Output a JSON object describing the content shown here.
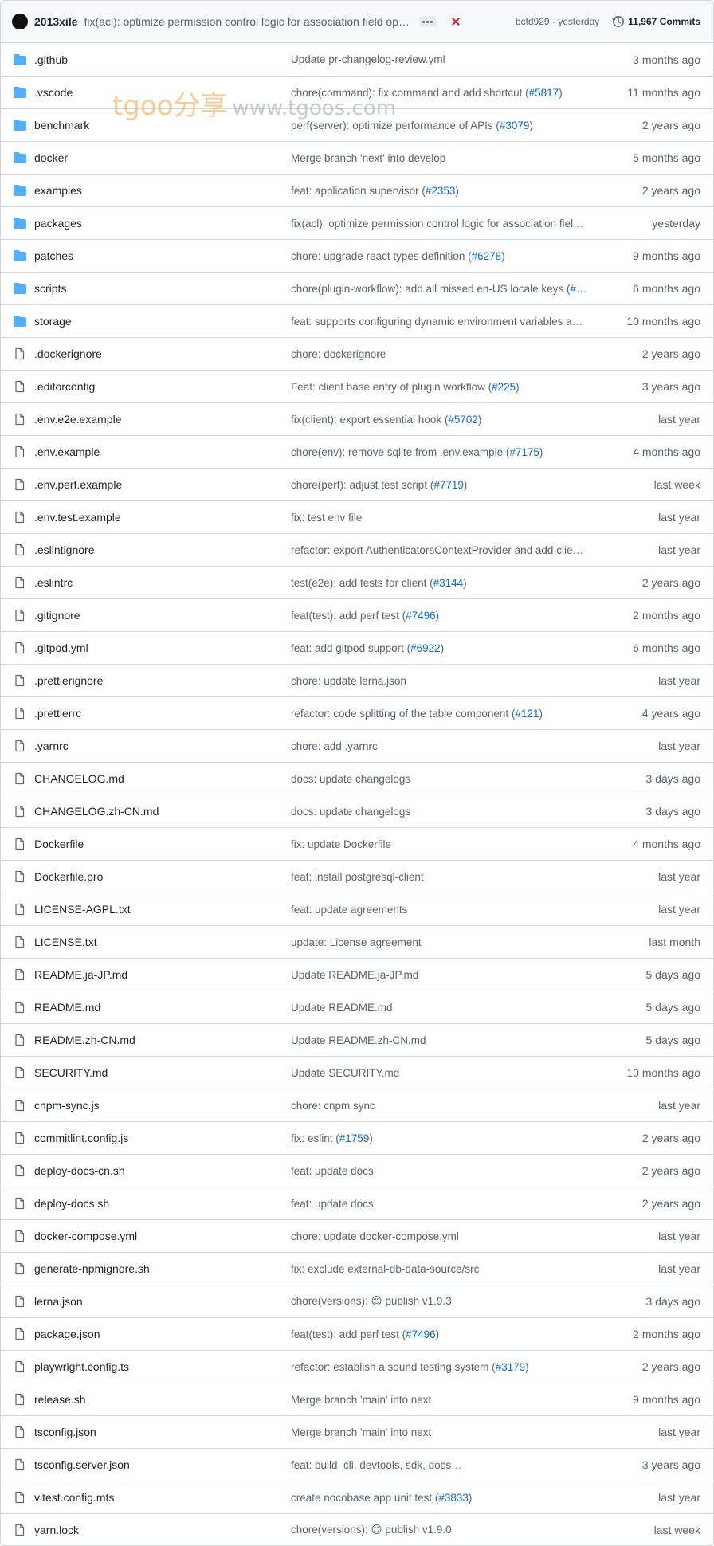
{
  "commit_bar": {
    "author": "2013xile",
    "message": "fix(acl): optimize permission control logic for association field operations",
    "sha": "bcfd929 · yesterday",
    "commits_label": "11,967 Commits"
  },
  "watermark": {
    "brand": "tgoo",
    "chinese": "分享",
    "url": "www.tgoos.com"
  },
  "colors": {
    "folder": "#54aeff",
    "link": "#0969da",
    "muted": "#59636e",
    "border": "#d0d7de",
    "failure": "#d1242f"
  },
  "files": [
    {
      "name": ".github",
      "type": "dir",
      "message": "Update pr-changelog-review.yml",
      "pr": "",
      "message_suffix": "",
      "age": "3 months ago"
    },
    {
      "name": ".vscode",
      "type": "dir",
      "message": "chore(command): fix command and add shortcut (",
      "pr": "#5817",
      "message_suffix": ")",
      "age": "11 months ago"
    },
    {
      "name": "benchmark",
      "type": "dir",
      "message": "perf(server): optimize performance of APIs (",
      "pr": "#3079",
      "message_suffix": ")",
      "age": "2 years ago"
    },
    {
      "name": "docker",
      "type": "dir",
      "message": "Merge branch 'next' into develop",
      "pr": "",
      "message_suffix": "",
      "age": "5 months ago"
    },
    {
      "name": "examples",
      "type": "dir",
      "message": "feat: application supervisor (",
      "pr": "#2353",
      "message_suffix": ")",
      "age": "2 years ago"
    },
    {
      "name": "packages",
      "type": "dir",
      "message": "fix(acl): optimize permission control logic for association fiel…",
      "pr": "",
      "message_suffix": "",
      "age": "yesterday"
    },
    {
      "name": "patches",
      "type": "dir",
      "message": "chore: upgrade react types definition (",
      "pr": "#6278",
      "message_suffix": ")",
      "age": "9 months ago"
    },
    {
      "name": "scripts",
      "type": "dir",
      "message": "chore(plugin-workflow): add all missed en-US locale keys (",
      "pr": "#…",
      "message_suffix": "",
      "age": "6 months ago"
    },
    {
      "name": "storage",
      "type": "dir",
      "message": "feat: supports configuring dynamic environment variables a…",
      "pr": "",
      "message_suffix": "",
      "age": "10 months ago"
    },
    {
      "name": ".dockerignore",
      "type": "file",
      "message": "chore: dockerignore",
      "pr": "",
      "message_suffix": "",
      "age": "2 years ago"
    },
    {
      "name": ".editorconfig",
      "type": "file",
      "message": "Feat: client base entry of plugin workflow (",
      "pr": "#225",
      "message_suffix": ")",
      "age": "3 years ago"
    },
    {
      "name": ".env.e2e.example",
      "type": "file",
      "message": "fix(client): export essential hook (",
      "pr": "#5702",
      "message_suffix": ")",
      "age": "last year"
    },
    {
      "name": ".env.example",
      "type": "file",
      "message": "chore(env): remove sqlite from .env.example (",
      "pr": "#7175",
      "message_suffix": ")",
      "age": "4 months ago"
    },
    {
      "name": ".env.perf.example",
      "type": "file",
      "message": "chore(perf): adjust test script (",
      "pr": "#7719",
      "message_suffix": ")",
      "age": "last week"
    },
    {
      "name": ".env.test.example",
      "type": "file",
      "message": "fix: test env file",
      "pr": "",
      "message_suffix": "",
      "age": "last year"
    },
    {
      "name": ".eslintignore",
      "type": "file",
      "message": "refactor: export AuthenticatorsContextProvider and add clie…",
      "pr": "",
      "message_suffix": "",
      "age": "last year"
    },
    {
      "name": ".eslintrc",
      "type": "file",
      "message": "test(e2e): add tests for client (",
      "pr": "#3144",
      "message_suffix": ")",
      "age": "2 years ago"
    },
    {
      "name": ".gitignore",
      "type": "file",
      "message": "feat(test): add perf test (",
      "pr": "#7496",
      "message_suffix": ")",
      "age": "2 months ago"
    },
    {
      "name": ".gitpod.yml",
      "type": "file",
      "message": "feat: add gitpod support (",
      "pr": "#6922",
      "message_suffix": ")",
      "age": "6 months ago"
    },
    {
      "name": ".prettierignore",
      "type": "file",
      "message": "chore: update lerna.json",
      "pr": "",
      "message_suffix": "",
      "age": "last year"
    },
    {
      "name": ".prettierrc",
      "type": "file",
      "message": "refactor: code splitting of the table component (",
      "pr": "#121",
      "message_suffix": ")",
      "age": "4 years ago"
    },
    {
      "name": ".yarnrc",
      "type": "file",
      "message": "chore: add .yarnrc",
      "pr": "",
      "message_suffix": "",
      "age": "last year"
    },
    {
      "name": "CHANGELOG.md",
      "type": "file",
      "message": "docs: update changelogs",
      "pr": "",
      "message_suffix": "",
      "age": "3 days ago"
    },
    {
      "name": "CHANGELOG.zh-CN.md",
      "type": "file",
      "message": "docs: update changelogs",
      "pr": "",
      "message_suffix": "",
      "age": "3 days ago"
    },
    {
      "name": "Dockerfile",
      "type": "file",
      "message": "fix: update Dockerfile",
      "pr": "",
      "message_suffix": "",
      "age": "4 months ago"
    },
    {
      "name": "Dockerfile.pro",
      "type": "file",
      "message": "feat: install postgresql-client",
      "pr": "",
      "message_suffix": "",
      "age": "last year"
    },
    {
      "name": "LICENSE-AGPL.txt",
      "type": "file",
      "message": "feat: update agreements",
      "pr": "",
      "message_suffix": "",
      "age": "last year"
    },
    {
      "name": "LICENSE.txt",
      "type": "file",
      "message": "update: License agreement",
      "pr": "",
      "message_suffix": "",
      "age": "last month"
    },
    {
      "name": "README.ja-JP.md",
      "type": "file",
      "message": "Update README.ja-JP.md",
      "pr": "",
      "message_suffix": "",
      "age": "5 days ago"
    },
    {
      "name": "README.md",
      "type": "file",
      "message": "Update README.md",
      "pr": "",
      "message_suffix": "",
      "age": "5 days ago"
    },
    {
      "name": "README.zh-CN.md",
      "type": "file",
      "message": "Update README.zh-CN.md",
      "pr": "",
      "message_suffix": "",
      "age": "5 days ago"
    },
    {
      "name": "SECURITY.md",
      "type": "file",
      "message": "Update SECURITY.md",
      "pr": "",
      "message_suffix": "",
      "age": "10 months ago"
    },
    {
      "name": "cnpm-sync.js",
      "type": "file",
      "message": "chore: cnpm sync",
      "pr": "",
      "message_suffix": "",
      "age": "last year"
    },
    {
      "name": "commitlint.config.js",
      "type": "file",
      "message": "fix: eslint (",
      "pr": "#1759",
      "message_suffix": ")",
      "age": "2 years ago"
    },
    {
      "name": "deploy-docs-cn.sh",
      "type": "file",
      "message": "feat: update docs",
      "pr": "",
      "message_suffix": "",
      "age": "2 years ago"
    },
    {
      "name": "deploy-docs.sh",
      "type": "file",
      "message": "feat: update docs",
      "pr": "",
      "message_suffix": "",
      "age": "2 years ago"
    },
    {
      "name": "docker-compose.yml",
      "type": "file",
      "message": "chore: update docker-compose.yml",
      "pr": "",
      "message_suffix": "",
      "age": "last year"
    },
    {
      "name": "generate-npmignore.sh",
      "type": "file",
      "message": "fix: exclude external-db-data-source/src",
      "pr": "",
      "message_suffix": "",
      "age": "last year"
    },
    {
      "name": "lerna.json",
      "type": "file",
      "message": "chore(versions): 😊 publish v1.9.3",
      "pr": "",
      "message_suffix": "",
      "age": "3 days ago"
    },
    {
      "name": "package.json",
      "type": "file",
      "message": "feat(test): add perf test (",
      "pr": "#7496",
      "message_suffix": ")",
      "age": "2 months ago"
    },
    {
      "name": "playwright.config.ts",
      "type": "file",
      "message": "refactor: establish a sound testing system (",
      "pr": "#3179",
      "message_suffix": ")",
      "age": "2 years ago"
    },
    {
      "name": "release.sh",
      "type": "file",
      "message": "Merge branch 'main' into next",
      "pr": "",
      "message_suffix": "",
      "age": "9 months ago"
    },
    {
      "name": "tsconfig.json",
      "type": "file",
      "message": "Merge branch 'main' into next",
      "pr": "",
      "message_suffix": "",
      "age": "last year"
    },
    {
      "name": "tsconfig.server.json",
      "type": "file",
      "message": "feat: build, cli, devtools, sdk, docs…",
      "pr": "",
      "message_suffix": "",
      "age": "3 years ago"
    },
    {
      "name": "vitest.config.mts",
      "type": "file",
      "message": "create nocobase app unit test (",
      "pr": "#3833",
      "message_suffix": ")",
      "age": "last year"
    },
    {
      "name": "yarn.lock",
      "type": "file",
      "message": "chore(versions): 😊 publish v1.9.0",
      "pr": "",
      "message_suffix": "",
      "age": "last week"
    }
  ]
}
